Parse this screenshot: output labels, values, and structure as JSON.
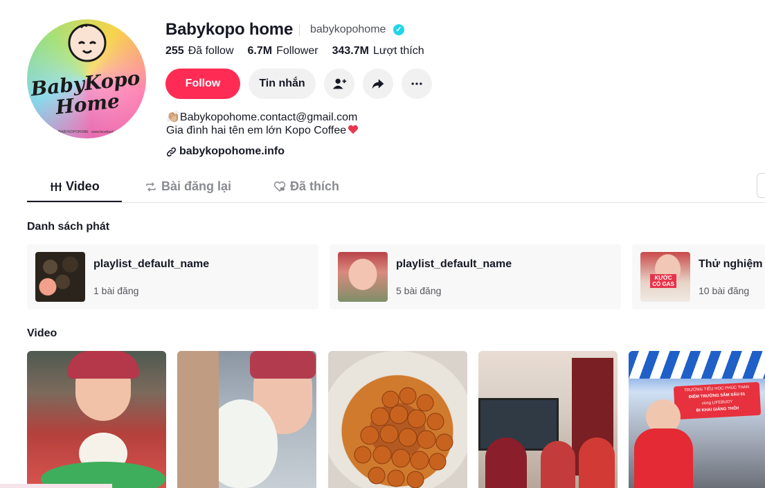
{
  "profile": {
    "name": "Babykopo home",
    "handle": "babykopohome",
    "avatar_text": "BabyKopo Home",
    "avatar_small_text": "www.youtube.com/c/BABYKOPOHOME · www.facebook.com/babykopohome"
  },
  "stats": {
    "following_value": "255",
    "following_label": "Đã follow",
    "followers_value": "6.7M",
    "followers_label": "Follower",
    "likes_value": "343.7M",
    "likes_label": "Lượt thích"
  },
  "buttons": {
    "follow": "Follow",
    "message": "Tin nhắn"
  },
  "bio": {
    "line1": "👏🏼Babykopohome.contact@gmail.com",
    "line2": "Gia đình hai tên em lớn Kopo Coffee",
    "link": "babykopohome.info"
  },
  "tabs": [
    {
      "label": "Video",
      "icon": "grid-icon",
      "active": true
    },
    {
      "label": "Bài đăng lại",
      "icon": "repost-icon",
      "active": false
    },
    {
      "label": "Đã thích",
      "icon": "heart-lock-icon",
      "active": false
    }
  ],
  "sections": {
    "playlists": "Danh sách phát",
    "videos": "Video"
  },
  "playlists": [
    {
      "name": "playlist_default_name",
      "count": "1 bài đăng"
    },
    {
      "name": "playlist_default_name",
      "count": "5 bài đăng"
    },
    {
      "name": "Thử nghiệm c",
      "count": "10 bài đăng",
      "badge": "KƯỚC CÓ GAS"
    }
  ],
  "videos": [
    {
      "thumb_text": ""
    },
    {
      "thumb_text": ""
    },
    {
      "thumb_text": ""
    },
    {
      "thumb_text": ""
    },
    {
      "banner_line1": "TRƯỜNG TIỂU HỌC PHÚC THAN",
      "banner_line2": "ĐIỂM TRƯỜNG SÂM SẤU 01",
      "banner_line3": "cùng LIFEBUOY",
      "banner_line4": "ĐI KHAI GIẢNG THÔI!"
    }
  ],
  "colors": {
    "accent": "#fe2c55",
    "verified": "#20d5ec",
    "text": "#161823",
    "muted": "#8a8b91"
  }
}
